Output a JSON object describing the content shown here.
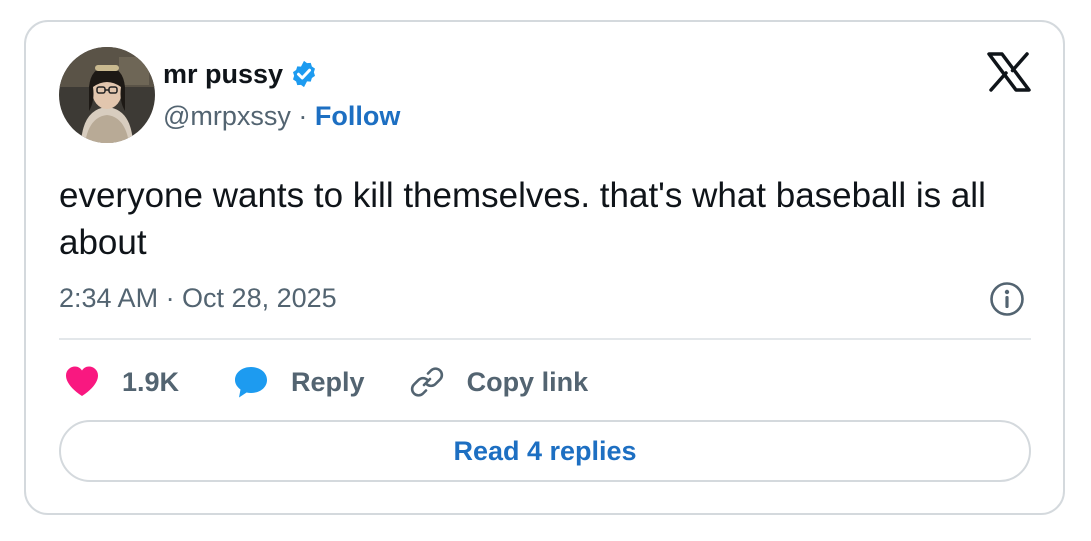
{
  "author": {
    "display_name": "mr pussy",
    "handle": "@mrpxssy",
    "separator": " · ",
    "follow_label": "Follow",
    "verified_color": "#1d9bf0"
  },
  "tweet": {
    "text": "everyone wants to kill themselves. that's what baseball is all about",
    "timestamp": "2:34 AM · Oct 28, 2025"
  },
  "actions": {
    "like_count": "1.9K",
    "reply_label": "Reply",
    "copy_link_label": "Copy link",
    "like_color": "#f91880",
    "reply_color": "#1d9bf0"
  },
  "footer": {
    "read_replies_label": "Read 4 replies"
  },
  "icons": {
    "brand": "x-logo-icon",
    "info": "info-icon",
    "like": "heart-icon",
    "reply": "speech-bubble-icon",
    "copy": "link-icon",
    "verified": "verified-badge-icon"
  }
}
